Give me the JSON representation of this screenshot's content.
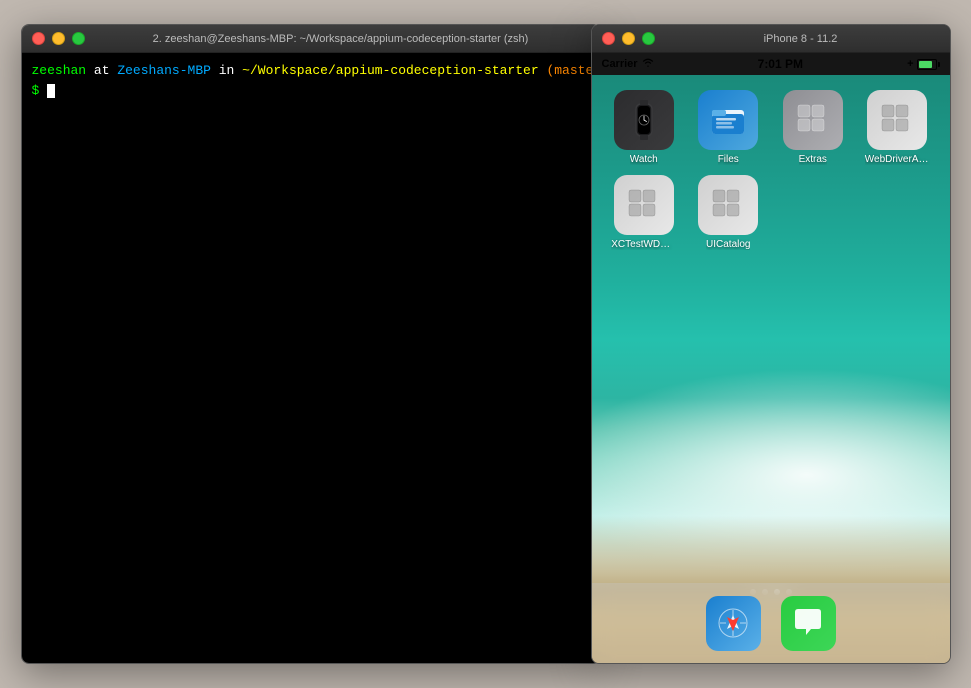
{
  "terminal": {
    "title": "2. zeeshan@Zeeshans-MBP: ~/Workspace/appium-codeception-starter (zsh)",
    "prompt_line": {
      "user": "zeeshan",
      "at": " at ",
      "host": "Zeeshans-MBP",
      "in": " in ",
      "path": "~/Workspace/appium-codeception-starter",
      "space": " ",
      "git": "(master●)",
      "newline_prompt": "\n$ "
    }
  },
  "simulator": {
    "title": "iPhone 8 - 11.2",
    "status_bar": {
      "carrier": "Carrier",
      "time": "7:01 PM",
      "battery_plus": "+"
    },
    "apps": [
      {
        "id": "watch",
        "label": "Watch",
        "icon_type": "watch"
      },
      {
        "id": "files",
        "label": "Files",
        "icon_type": "files"
      },
      {
        "id": "extras",
        "label": "Extras",
        "icon_type": "extras"
      },
      {
        "id": "webdriveragent",
        "label": "WebDriverAg...",
        "icon_type": "webdriver"
      },
      {
        "id": "xctestwdui",
        "label": "XCTestWDUI...",
        "icon_type": "xctest"
      },
      {
        "id": "uicatalog",
        "label": "UICatalog",
        "icon_type": "uicatalog"
      }
    ],
    "dock_apps": [
      {
        "id": "safari",
        "label": "Safari",
        "icon_type": "safari"
      },
      {
        "id": "messages",
        "label": "Messages",
        "icon_type": "messages"
      }
    ],
    "page_dots": [
      false,
      false,
      true,
      false
    ]
  },
  "traffic_lights": {
    "close": "close",
    "minimize": "minimize",
    "maximize": "maximize"
  }
}
